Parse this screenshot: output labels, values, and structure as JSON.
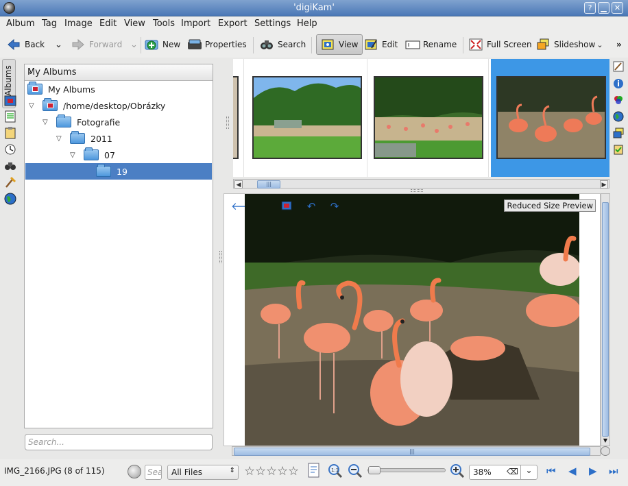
{
  "window": {
    "title": "'digiKam'"
  },
  "menu": [
    "Album",
    "Tag",
    "Image",
    "Edit",
    "View",
    "Tools",
    "Import",
    "Export",
    "Settings",
    "Help"
  ],
  "toolbar": {
    "back": "Back",
    "forward": "Forward",
    "new": "New",
    "properties": "Properties",
    "search": "Search",
    "view": "View",
    "edit": "Edit",
    "rename": "Rename",
    "fullscreen": "Full Screen",
    "slideshow": "Slideshow",
    "more": "»"
  },
  "left_tabs": {
    "albums": "Albums"
  },
  "album_panel": {
    "combo": "My Albums",
    "tree": [
      {
        "label": "My Albums",
        "type": "root"
      },
      {
        "label": "/home/desktop/Obrázky",
        "type": "collection"
      },
      {
        "label": "Fotografie",
        "type": "folder"
      },
      {
        "label": "2011",
        "type": "folder"
      },
      {
        "label": "07",
        "type": "folder"
      },
      {
        "label": "19",
        "type": "folder",
        "selected": true
      }
    ],
    "search_placeholder": "Search..."
  },
  "preview": {
    "badge": "Reduced Size Preview"
  },
  "status": {
    "filename": "IMG_2166.JPG (8 of 115)",
    "search_placeholder": "Sea",
    "filter": "All Files",
    "zoom": "38%"
  },
  "colors": {
    "selection": "#4b7fc4",
    "thumb_selection": "#3d97e6",
    "titlebar": "#5c86bf"
  }
}
